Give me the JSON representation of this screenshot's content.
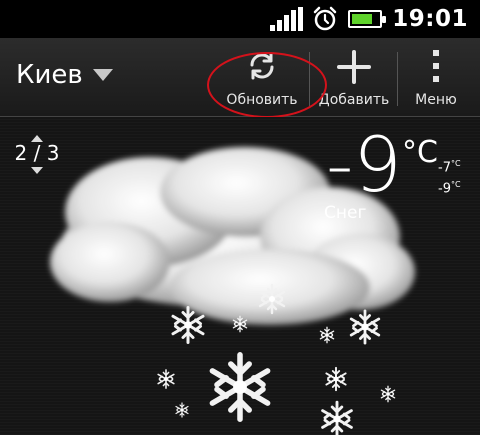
{
  "status_bar": {
    "time": "19:01",
    "icons": [
      "signal-icon",
      "alarm-clock-icon",
      "battery-icon"
    ],
    "battery_level_fraction": 0.75,
    "battery_color": "#5fd22b"
  },
  "action_bar": {
    "city": "Киев",
    "refresh_label": "Обновить",
    "add_label": "Добавить",
    "menu_label": "Меню"
  },
  "weather": {
    "page_indicator": "2 / 3",
    "temperature": "-9",
    "unit": "°C",
    "high": "-7",
    "low": "-9",
    "small_unit": "°C",
    "condition": "Снег",
    "illustration": "cloud-with-snowflakes-icon"
  },
  "colors": {
    "highlight_circle": "#d4121b",
    "background": "#151515"
  }
}
